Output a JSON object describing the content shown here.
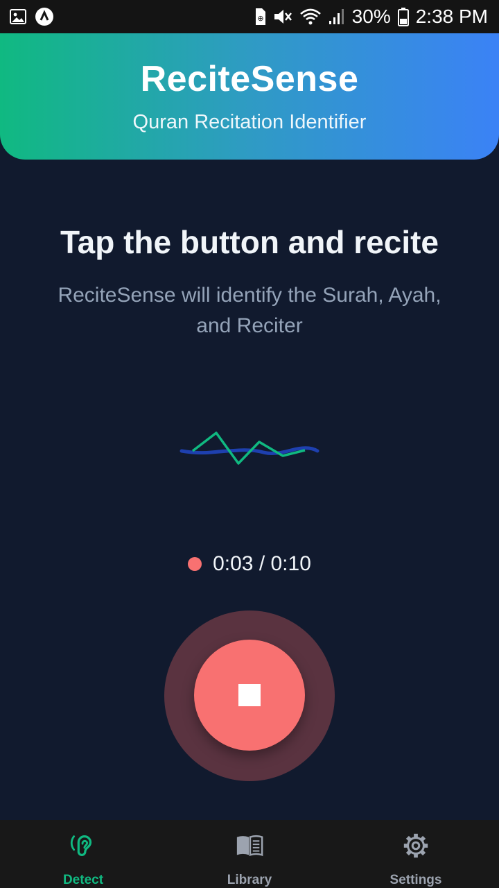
{
  "status_bar": {
    "battery": "30%",
    "time": "2:38 PM",
    "left_icons": [
      "image-icon",
      "app-launcher-icon"
    ],
    "right_icons": [
      "storage-icon",
      "mute-icon",
      "wifi-icon",
      "signal-icon",
      "battery-icon"
    ]
  },
  "header": {
    "title": "ReciteSense",
    "subtitle": "Quran Recitation Identifier",
    "gradient_start": "#10b981",
    "gradient_end": "#3b82f6"
  },
  "main": {
    "title": "Tap the button and recite",
    "description": "ReciteSense will identify the Surah, Ayah, and Reciter",
    "timer": "0:03 / 0:10",
    "recording_color": "#f87171",
    "record_button_icon": "stop-icon"
  },
  "nav": {
    "items": [
      {
        "label": "Detect",
        "icon": "ear-icon",
        "active": true
      },
      {
        "label": "Library",
        "icon": "book-icon",
        "active": false
      },
      {
        "label": "Settings",
        "icon": "gear-icon",
        "active": false
      }
    ],
    "active_color": "#10b981",
    "inactive_color": "#9ca3af"
  }
}
